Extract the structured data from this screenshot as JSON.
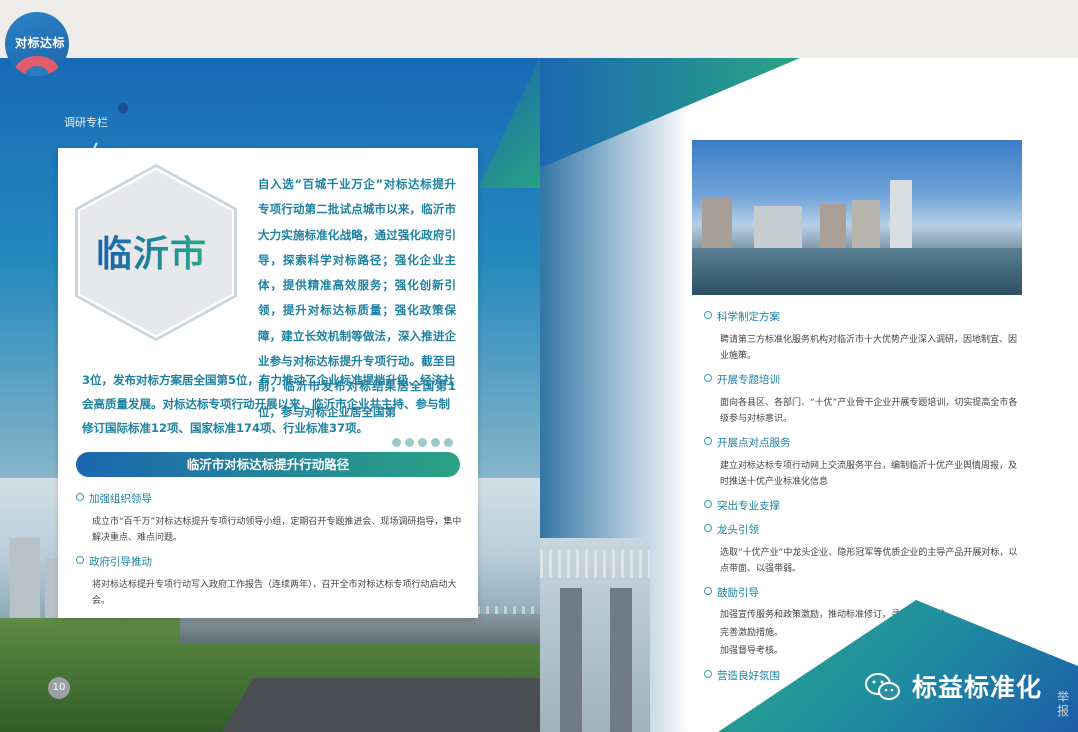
{
  "logo": {
    "text": "对标达标"
  },
  "left": {
    "section_tag": "调研专栏",
    "city_title": "临沂市",
    "intro_top": "自入选“百城千业万企”对标达标提升专项行动第二批试点城市以来，临沂市大力实施标准化战略，通过强化政府引导，探索科学对标路径；强化企业主体，提供精准高效服务；强化创新引领，提升对标达标质量；强化政策保障，建立长效机制等做法，深入推进企业参与对标达标提升专项行动。截至目前，临沂市发布对标结果居全国第1位，参与对标企业居全国第",
    "intro_bottom": "3位，发布对标方案居全国第5位，有力推动了企业标准提档升级、经济社会高质量发展。对标达标专项行动开展以来，临沂市企业共主持、参与制修订国际标准12项、国家标准174项、行业标准37项。",
    "banner": "临沂市对标达标提升行动路径",
    "items": [
      {
        "head": "加强组织领导",
        "body": "成立市“百千万”对标达标提升专项行动领导小组，定期召开专题推进会、现场调研指导，集中解决重点、难点问题。"
      },
      {
        "head": "政府引导推动",
        "body": "将对标达标提升专项行动写入政府工作报告（连续两年），召开全市对标达标专项行动启动大会。"
      }
    ],
    "page_number": "10"
  },
  "right": {
    "items": [
      {
        "head": "科学制定方案",
        "body": "聘请第三方标准化服务机构对临沂市十大优势产业深入调研，因地制宜、因业施策。"
      },
      {
        "head": "开展专题培训",
        "body": "面向各县区、各部门、“十优”产业骨干企业开展专题培训，切实提高全市各级参与对标意识。"
      },
      {
        "head": "开展点对点服务",
        "body": "建立对标达标专项行动网上交流服务平台，编制临沂十优产业舆情周报，及时推送十优产业标准化信息"
      },
      {
        "head": "突出专业支撑",
        "body": ""
      },
      {
        "head": "龙头引领",
        "body": "选取“十优产业”中龙头企业、隐形冠军等优质企业的主导产品开展对标，以点带面、以强带弱。"
      },
      {
        "head": "鼓励引导",
        "body": "加强宣传服务和政策激励，推动标准修订，寻求标准突破，\n完善激励措施。\n加强督导考核。"
      },
      {
        "head": "营造良好氛围",
        "body": ""
      }
    ],
    "watermark": "标益标准化",
    "report_text": "举报"
  },
  "colors": {
    "primary_blue": "#1c66b0",
    "primary_green": "#2aa283",
    "text_teal": "#1f82a2"
  }
}
